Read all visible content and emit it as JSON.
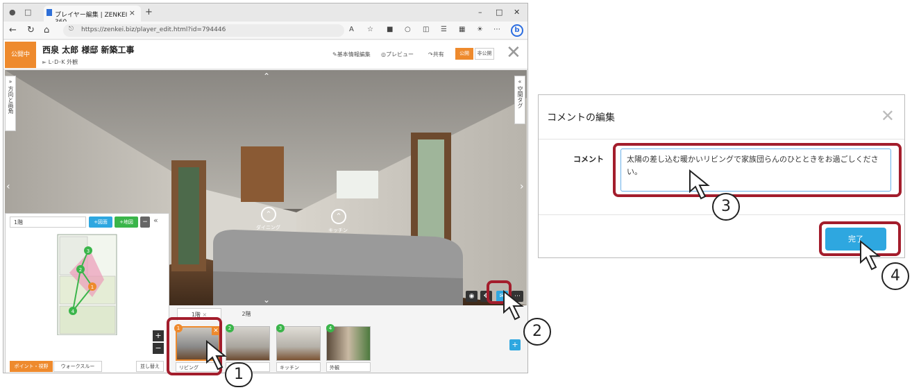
{
  "browser": {
    "tab_title": "プレイヤー編集 | ZENKEI 360",
    "url": "https://zenkei.biz/player_edit.html?id=794446"
  },
  "header": {
    "status": "公開中",
    "title": "西泉 太郎 様邸 新築工事",
    "tags": "L･D･K 外観",
    "links": [
      "基本情報編集",
      "プレビュー",
      "共有"
    ],
    "publish": "公開",
    "unpublish": "非公開"
  },
  "viewer": {
    "left_tab": "方向と画角",
    "right_tab": "空間タグ",
    "hotspots": [
      {
        "label": "ダイニング"
      },
      {
        "label": "キッチン"
      }
    ]
  },
  "floor_panel": {
    "floor": "1階",
    "add_plan": "+図面",
    "add_map": "+地図",
    "minus": "−",
    "zoom_in": "+",
    "zoom_out": "−",
    "mode_point": "ポイント・視野",
    "mode_walk": "ウォークスルー",
    "reorder": "並し替え",
    "markers": [
      "1",
      "2",
      "3",
      "4"
    ]
  },
  "thumbs": {
    "floor_tabs": [
      "1階",
      "2階"
    ],
    "items": [
      {
        "num": "1",
        "label": "リビング",
        "color": "#ee8a2d"
      },
      {
        "num": "2",
        "label": "",
        "color": "#3ab54a"
      },
      {
        "num": "3",
        "label": "キッチン",
        "color": "#3ab54a"
      },
      {
        "num": "4",
        "label": "外観",
        "color": "#3ab54a"
      }
    ],
    "add": "+"
  },
  "dialog": {
    "title": "コメントの編集",
    "label": "コメント",
    "comment": "太陽の差し込む暖かいリビングで家族団らんのひとときをお過ごしください。",
    "done": "完了"
  },
  "callouts": [
    "1",
    "2",
    "3",
    "4"
  ],
  "colors": {
    "accent": "#ee8a2d",
    "highlight": "#a31d2c",
    "primary": "#2ea7e0",
    "green": "#3ab54a"
  }
}
